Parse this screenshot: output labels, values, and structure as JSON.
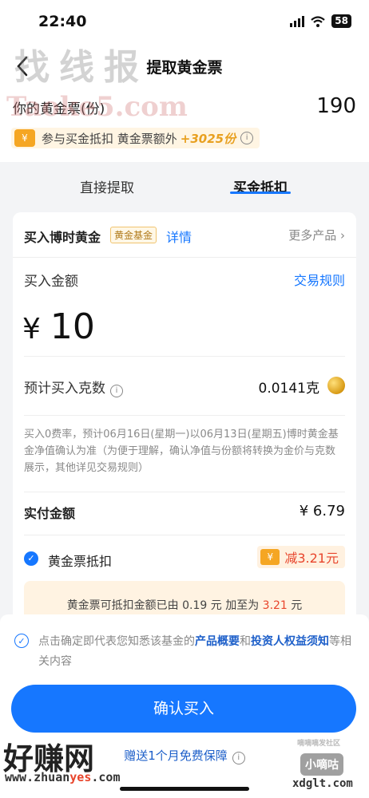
{
  "status_bar": {
    "time": "22:40",
    "battery": "58"
  },
  "nav": {
    "title": "提取黄金票"
  },
  "summary": {
    "tickets_label": "你的黄金票(份)",
    "tickets_count": "190",
    "promo_tag": "¥",
    "promo_text": "参与买金抵扣 黄金票额外",
    "promo_extra": "+3025份"
  },
  "tabs": [
    {
      "label": "直接提取",
      "active": false
    },
    {
      "label": "买金抵扣",
      "active": true
    }
  ],
  "fund": {
    "name": "买入博时黄金",
    "badge": "黄金基金",
    "detail": "详情",
    "more": "更多产品"
  },
  "purchase": {
    "amount_label": "买入金额",
    "trade_rules": "交易规则",
    "currency": "¥",
    "amount": "10",
    "grams_label": "预计买入克数",
    "grams_value": "0.0141克",
    "note": "买入0费率，预计06月16日(星期一)以06月13日(星期五)博时黄金基金净值确认为准（为便于理解，确认净值与份额将转换为金价与克数展示，其他详见交易规则）",
    "pay_label": "实付金额",
    "pay_value": "¥ 6.79",
    "deduct_label": "黄金票抵扣",
    "deduct_coupon": "¥",
    "deduct_amount": "减3.21元",
    "tip_prefix": "黄金票可抵扣金额已由 0.19 元 加至为 ",
    "tip_highlight": "3.21",
    "tip_suffix": " 元"
  },
  "footer": {
    "agree_prefix": "点击确定即代表您知悉该基金的",
    "agree_link1": "产品概要",
    "agree_and": "和",
    "agree_link2": "投资人权益须知",
    "agree_suffix": "等相关内容",
    "confirm": "确认买入",
    "guarantee": "赠送1个月免费保障"
  },
  "watermarks": {
    "top": "找线报",
    "taoke": "Taoke5.com",
    "haozhuan": "好赚网",
    "url_a": "www.zhuan",
    "url_b": "yes",
    "url_c": ".com",
    "xiaodigu": "小嘀咕",
    "xdglt": "xdglt.com",
    "small": "嘀嘀嘀发社区"
  },
  "colors": {
    "accent": "#1677ff",
    "gold": "#f5a623",
    "red": "#e8452c"
  }
}
